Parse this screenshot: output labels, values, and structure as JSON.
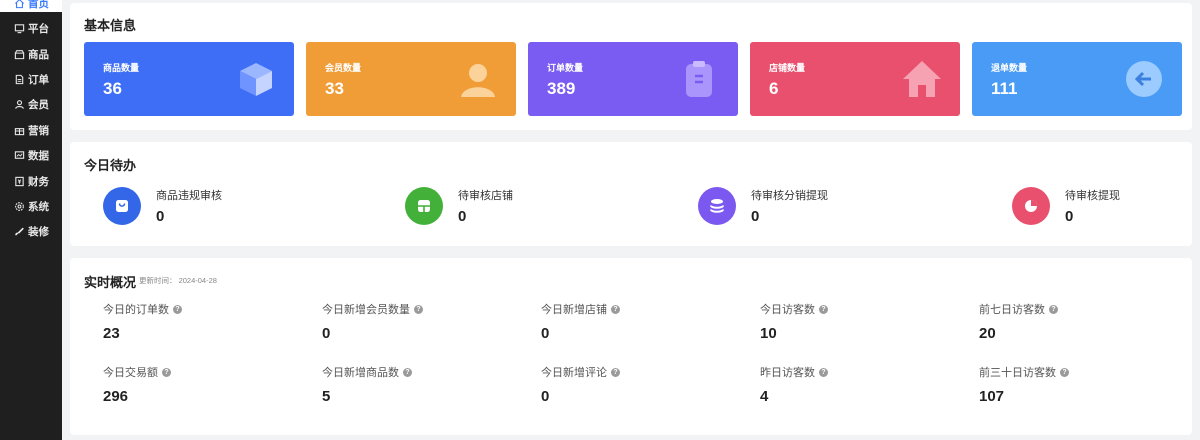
{
  "sidebar": {
    "items": [
      {
        "label": "首页",
        "icon": "home-icon",
        "active": true
      },
      {
        "label": "平台",
        "icon": "monitor-icon"
      },
      {
        "label": "商品",
        "icon": "shop-icon"
      },
      {
        "label": "订单",
        "icon": "document-icon"
      },
      {
        "label": "会员",
        "icon": "users-icon"
      },
      {
        "label": "营销",
        "icon": "gift-icon"
      },
      {
        "label": "数据",
        "icon": "chart-icon"
      },
      {
        "label": "财务",
        "icon": "finance-icon"
      },
      {
        "label": "系统",
        "icon": "gear-icon"
      },
      {
        "label": "装修",
        "icon": "brush-icon"
      }
    ]
  },
  "basic_info": {
    "title": "基本信息",
    "tiles": [
      {
        "label": "商品数量",
        "value": "36",
        "color": "#3e6ef6",
        "icon": "cube-icon"
      },
      {
        "label": "会员数量",
        "value": "33",
        "color": "#f19d37",
        "icon": "person-icon"
      },
      {
        "label": "订单数量",
        "value": "389",
        "color": "#7a5cf3",
        "icon": "clipboard-icon"
      },
      {
        "label": "店铺数量",
        "value": "6",
        "color": "#e8506e",
        "icon": "house-icon"
      },
      {
        "label": "退单数量",
        "value": "111",
        "color": "#4a9bf6",
        "icon": "arrow-left-circle-icon"
      }
    ]
  },
  "todo": {
    "title": "今日待办",
    "items": [
      {
        "label": "商品违规审核",
        "value": "0",
        "color": "#3367e8",
        "icon": "bag-icon"
      },
      {
        "label": "待审核店铺",
        "value": "0",
        "color": "#43b03a",
        "icon": "store-icon"
      },
      {
        "label": "待审核分销提现",
        "value": "0",
        "color": "#7b58ef",
        "icon": "coins-icon"
      },
      {
        "label": "待审核提现",
        "value": "0",
        "color": "#e8506e",
        "icon": "pie-icon"
      }
    ]
  },
  "realtime": {
    "title": "实时概况",
    "update_time": "更新时间：  2024-04-28",
    "help_icon": "?",
    "items": [
      {
        "label": "今日的订单数",
        "value": "23"
      },
      {
        "label": "今日新增会员数量",
        "value": "0"
      },
      {
        "label": "今日新增店铺",
        "value": "0"
      },
      {
        "label": "今日访客数",
        "value": "10"
      },
      {
        "label": "前七日访客数",
        "value": "20"
      },
      {
        "label": "今日交易额",
        "value": "296"
      },
      {
        "label": "今日新增商品数",
        "value": "5"
      },
      {
        "label": "今日新增评论",
        "value": "0"
      },
      {
        "label": "昨日访客数",
        "value": "4"
      },
      {
        "label": "前三十日访客数",
        "value": "107"
      }
    ]
  }
}
